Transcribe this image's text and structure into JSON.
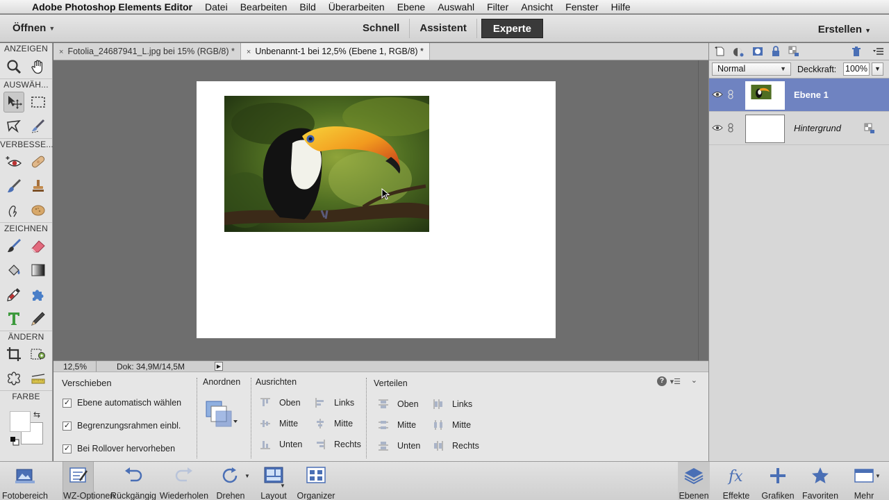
{
  "menubar": {
    "app_name": "Adobe Photoshop Elements Editor",
    "items": [
      "Datei",
      "Bearbeiten",
      "Bild",
      "Überarbeiten",
      "Ebene",
      "Auswahl",
      "Filter",
      "Ansicht",
      "Fenster",
      "Hilfe"
    ]
  },
  "appbar": {
    "open_label": "Öffnen",
    "modes": [
      "Schnell",
      "Assistent",
      "Experte"
    ],
    "active_mode": "Experte",
    "create_label": "Erstellen"
  },
  "toolbox": {
    "sections": [
      "ANZEIGEN",
      "AUSWÄH...",
      "VERBESSE...",
      "ZEICHNEN",
      "ÄNDERN",
      "FARBE"
    ]
  },
  "tabs": [
    {
      "label": "Fotolia_24687941_L.jpg bei 15% (RGB/8) *",
      "active": false
    },
    {
      "label": "Unbenannt-1 bei 12,5% (Ebene 1, RGB/8) *",
      "active": true
    }
  ],
  "status": {
    "zoom": "12,5%",
    "doc_size": "Dok: 34,9M/14,5M"
  },
  "options": {
    "tool_title": "Verschieben",
    "checks": [
      {
        "label": "Ebene automatisch wählen",
        "checked": true
      },
      {
        "label": "Begrenzungsrahmen einbl.",
        "checked": true
      },
      {
        "label": "Bei Rollover hervorheben",
        "checked": true
      }
    ],
    "arrange_title": "Anordnen",
    "align_title": "Ausrichten",
    "align_items": [
      "Oben",
      "Mitte",
      "Unten",
      "Links",
      "Mitte",
      "Rechts"
    ],
    "distribute_title": "Verteilen",
    "distribute_items": [
      "Oben",
      "Mitte",
      "Unten",
      "Links",
      "Mitte",
      "Rechts"
    ]
  },
  "layers_panel": {
    "blend_mode": "Normal",
    "opacity_label": "Deckkraft:",
    "opacity_value": "100%",
    "layers": [
      {
        "name": "Ebene 1",
        "selected": true,
        "visible": true
      },
      {
        "name": "Hintergrund",
        "selected": false,
        "visible": true,
        "locked": true
      }
    ]
  },
  "bottombar": {
    "left": [
      "Fotobereich",
      "WZ-Optionen",
      "Rückgängig",
      "Wiederholen",
      "Drehen",
      "Layout",
      "Organizer"
    ],
    "right": [
      "Ebenen",
      "Effekte",
      "Grafiken",
      "Favoriten",
      "Mehr"
    ],
    "selected_left": "WZ-Optionen",
    "selected_right": "Ebenen"
  },
  "colors": {
    "accent_selection": "#6f83c1",
    "active_mode_bg": "#3a3a3a",
    "canvas_bg": "#6e6e6e"
  }
}
